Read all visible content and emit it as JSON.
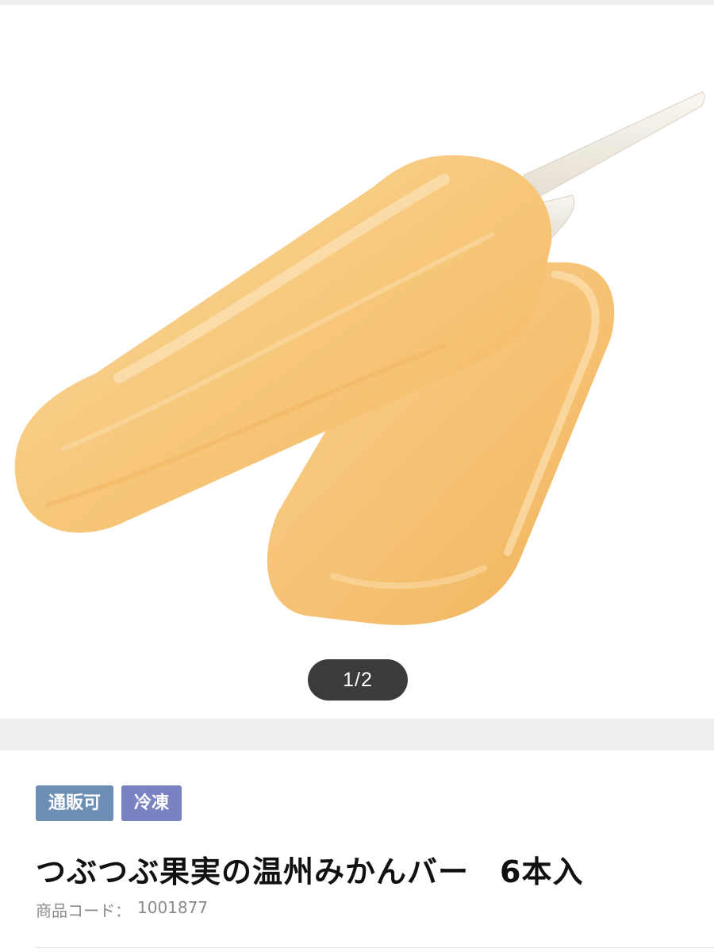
{
  "gallery": {
    "pager_text": "1/2",
    "image_subject": "product-photo-orange-ice-bars"
  },
  "tags": {
    "mail_order": "通販可",
    "frozen": "冷凍"
  },
  "product": {
    "title": "つぶつぶ果実の温州みかんバー　6本入",
    "code_label": "商品コード：",
    "code_value": "1001877"
  },
  "colors": {
    "tag_mail_order": "#6e8fb5",
    "tag_frozen": "#7a82c2",
    "pager_bg": "#3b3b3b",
    "band_gray": "#eeeeee",
    "ice_bar": "#f6c77c",
    "stick": "#f3eee4"
  }
}
